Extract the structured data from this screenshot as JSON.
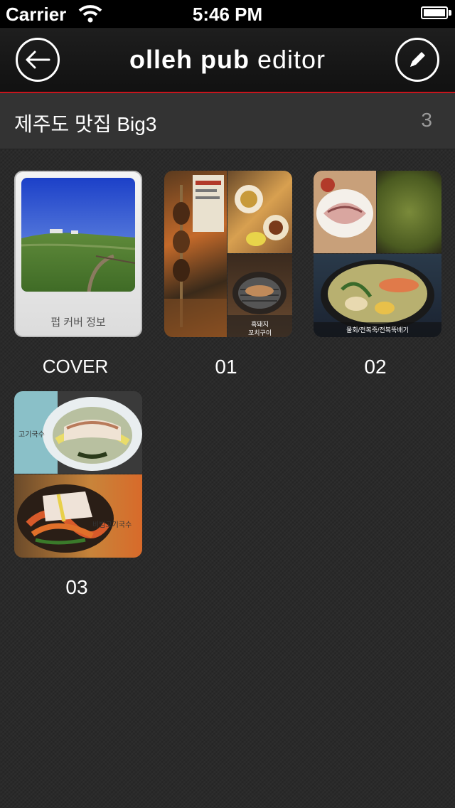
{
  "status_bar": {
    "carrier": "Carrier",
    "time": "5:46 PM"
  },
  "nav": {
    "title_bold": "olleh pub",
    "title_light": "editor",
    "back_icon": "back-arrow-icon",
    "edit_icon": "pencil-icon"
  },
  "book": {
    "title": "제주도 맛집 Big3",
    "page_count": "3"
  },
  "pages": [
    {
      "label": "COVER",
      "caption": "펍 커버 정보"
    },
    {
      "label": "01",
      "photo_caption_1": "흑돼지",
      "photo_caption_2": "꼬치구이"
    },
    {
      "label": "02",
      "photo_caption": "물회/전복죽/전복뚝배기"
    },
    {
      "label": "03",
      "photo_caption_top": "고기국수",
      "photo_caption_bottom": "비빔고기국수"
    }
  ],
  "colors": {
    "accent": "#c8151d",
    "background": "#2a2a2a"
  }
}
